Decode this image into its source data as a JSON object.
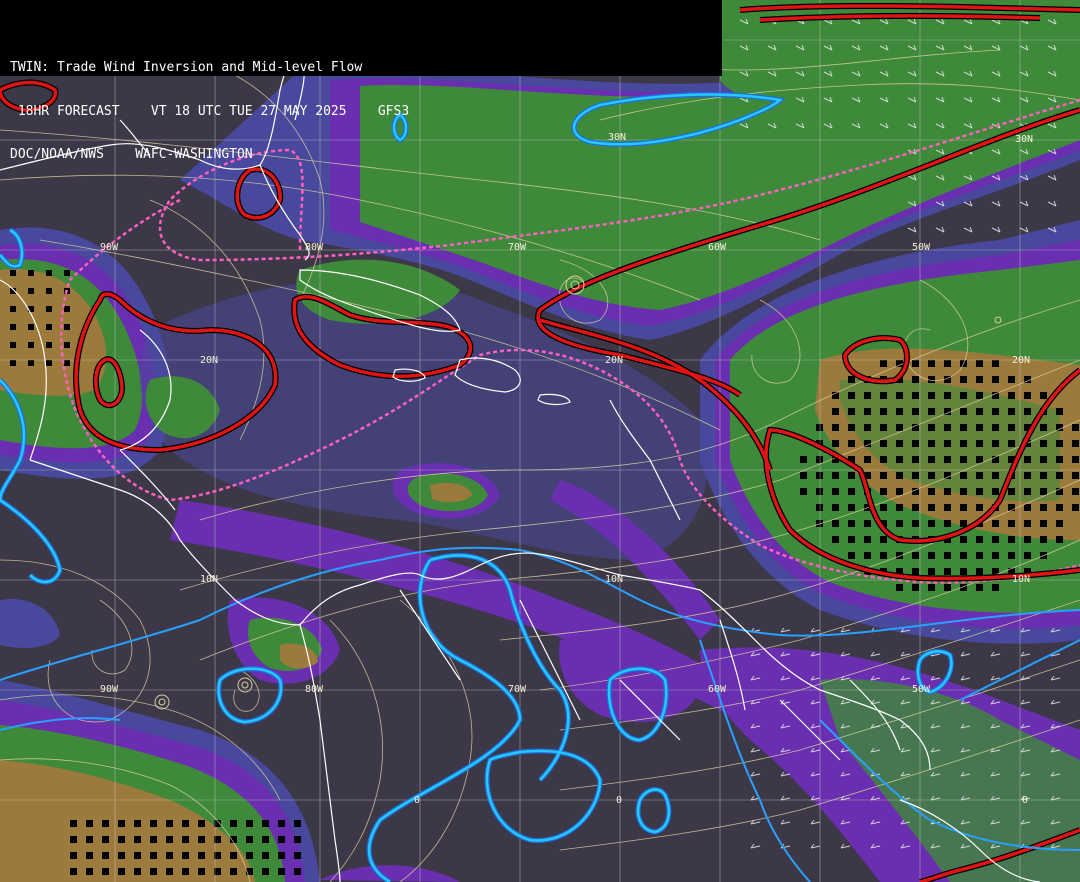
{
  "header": {
    "title": "TWIN: Trade Wind Inversion and Mid-level Flow",
    "line2": " 18HR FORECAST    VT 18 UTC TUE 27 MAY 2025    GFS3",
    "line3": "DOC/NOAA/NWS    WAFC-WASHINGTON"
  },
  "labels": {
    "lon_top": [
      "90W",
      "80W",
      "70W",
      "60W",
      "50W"
    ],
    "lon_mid": [
      "90W",
      "80W",
      "70W",
      "60W",
      "50W"
    ],
    "lat": [
      "30N",
      "20N",
      "20N",
      "20N",
      "10N",
      "10N",
      "10N",
      "0",
      "0"
    ],
    "contour_blue": "30N",
    "contour_cyan": "0"
  },
  "colors": {
    "background": "#3d3848",
    "purple_band": "#6a2fb0",
    "blue_band": "#48489c",
    "green_band": "#3f8a3a",
    "dark_green": "#2f6e3a",
    "tan_band": "#9c7a3c",
    "red_contour": "#e01414",
    "pink_dashed": "#ff60c0",
    "cyan_contour": "#28c8ff",
    "streamline": "#d8cfa0",
    "coastline": "#ffffff",
    "grid": "#c8c8c8"
  },
  "legend_icons": [
    "streamline-icon",
    "wind-barb-icon"
  ]
}
